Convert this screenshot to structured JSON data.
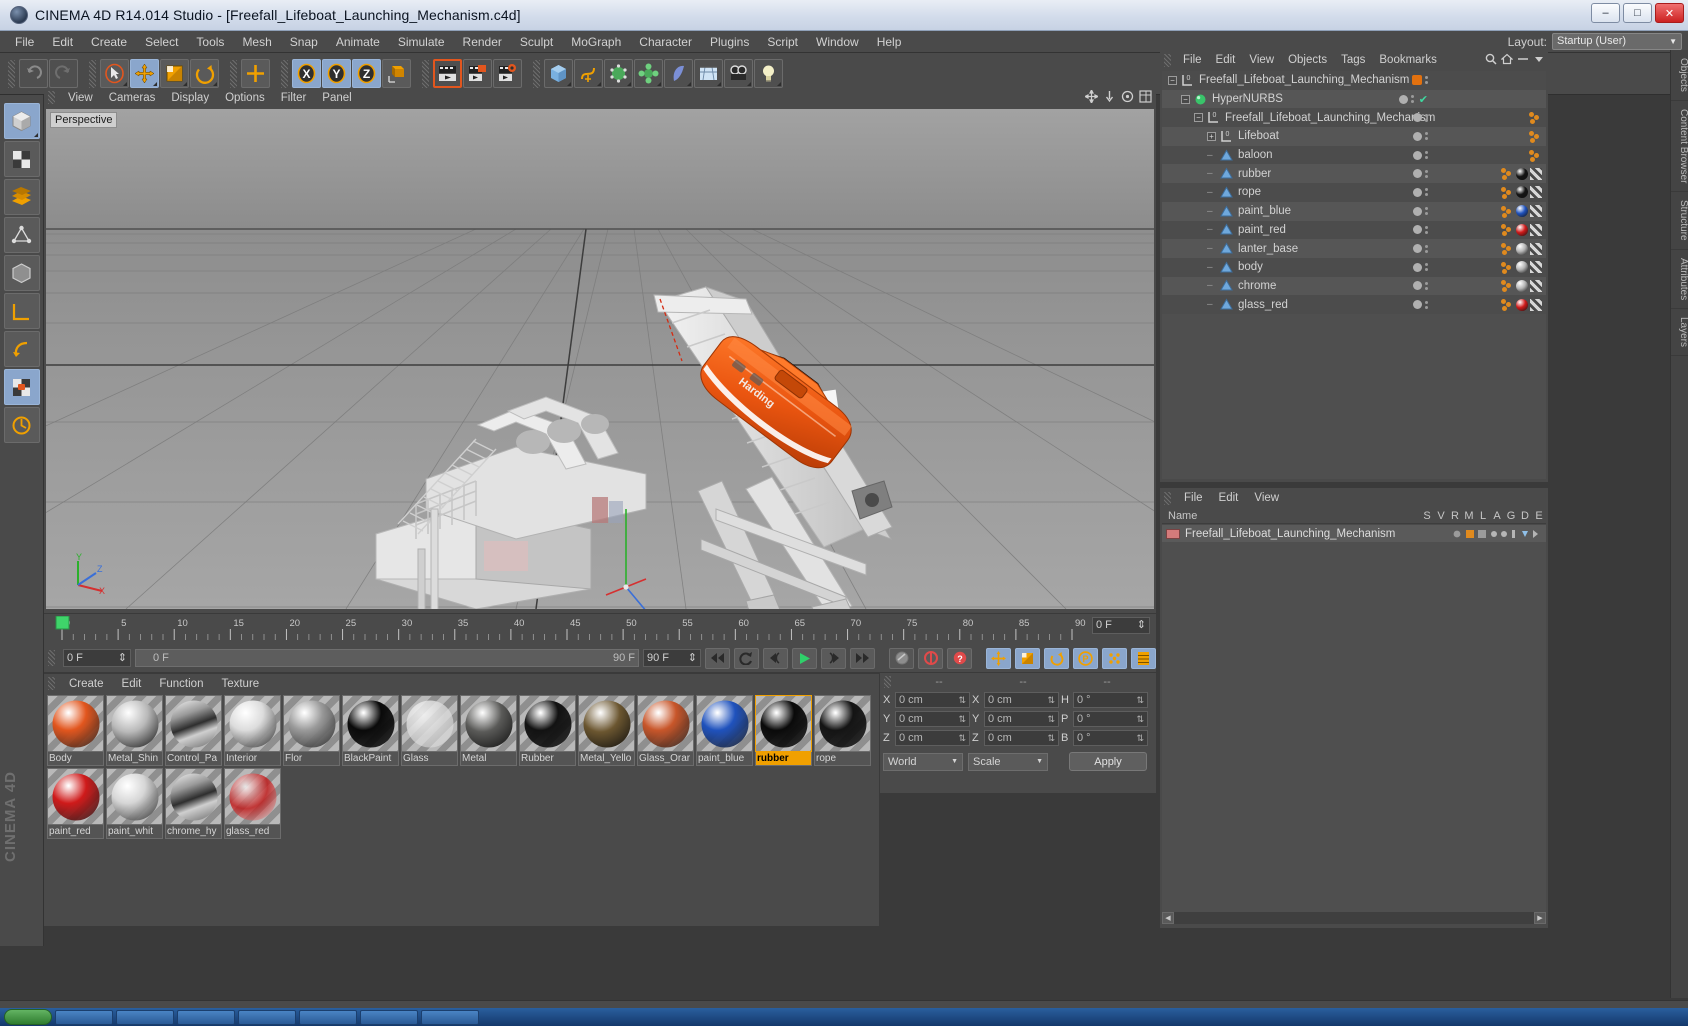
{
  "window": {
    "title": "CINEMA 4D R14.014 Studio - [Freefall_Lifeboat_Launching_Mechanism.c4d]",
    "minimize": "–",
    "maximize": "□",
    "close": "✕"
  },
  "menubar": {
    "items": [
      "File",
      "Edit",
      "Create",
      "Select",
      "Tools",
      "Mesh",
      "Snap",
      "Animate",
      "Simulate",
      "Render",
      "Sculpt",
      "MoGraph",
      "Character",
      "Plugins",
      "Script",
      "Window",
      "Help"
    ],
    "layout_label": "Layout:",
    "layout_value": "Startup (User)"
  },
  "viewport": {
    "menu": [
      "View",
      "Cameras",
      "Display",
      "Options",
      "Filter",
      "Panel"
    ],
    "view_label": "Perspective",
    "axis_x": "X",
    "axis_y": "Y",
    "axis_z": "Z"
  },
  "timeline": {
    "tick_labels": [
      "0",
      "5",
      "10",
      "15",
      "20",
      "25",
      "30",
      "35",
      "40",
      "45",
      "50",
      "55",
      "60",
      "65",
      "70",
      "75",
      "80",
      "85",
      "90"
    ],
    "current_frame_top": "0 F",
    "current_frame": "0 F",
    "scrub_start": "0 F",
    "scrub_end": "90 F",
    "range_end": "90 F"
  },
  "materials": {
    "menu": [
      "Create",
      "Edit",
      "Function",
      "Texture"
    ],
    "items": [
      {
        "name": "Body",
        "color": "#e2561e",
        "type": "glossy",
        "selected": false
      },
      {
        "name": "Metal_Shin",
        "color": "#b9b9b9",
        "type": "metal",
        "selected": false
      },
      {
        "name": "Control_Pa",
        "color": "#8c8c8c",
        "type": "chrome",
        "selected": false
      },
      {
        "name": "Interior",
        "color": "#dcdcdc",
        "type": "matte",
        "selected": false
      },
      {
        "name": "Flor",
        "color": "#9a9a9a",
        "type": "matte",
        "selected": false
      },
      {
        "name": "BlackPaint",
        "color": "#0a0a0a",
        "type": "glossy",
        "selected": false
      },
      {
        "name": "Glass",
        "color": "#d8d8d8",
        "type": "glass",
        "selected": false
      },
      {
        "name": "Metal",
        "color": "#5a5a58",
        "type": "metal",
        "selected": false
      },
      {
        "name": "Rubber",
        "color": "#121212",
        "type": "matte",
        "selected": false
      },
      {
        "name": "Metal_Yello",
        "color": "#6b5630",
        "type": "metal",
        "selected": false
      },
      {
        "name": "Glass_Orar",
        "color": "#c8562a",
        "type": "glossy",
        "selected": false
      },
      {
        "name": "paint_blue",
        "color": "#1f52bd",
        "type": "glossy",
        "selected": false
      },
      {
        "name": "rubber",
        "color": "#0a0a0a",
        "type": "matte",
        "selected": true
      },
      {
        "name": "rope",
        "color": "#141414",
        "type": "matte",
        "selected": false
      },
      {
        "name": "paint_red",
        "color": "#cf1a1a",
        "type": "glossy",
        "selected": false
      },
      {
        "name": "paint_whit",
        "color": "#d6d6d6",
        "type": "matte",
        "selected": false
      },
      {
        "name": "chrome_hy",
        "color": "#b4b4b4",
        "type": "chrome",
        "selected": false
      },
      {
        "name": "glass_red",
        "color": "#c21a1a",
        "type": "glass",
        "selected": false
      }
    ]
  },
  "coordinates": {
    "header": [
      "--",
      "--",
      "--"
    ],
    "rows": [
      {
        "label": "X",
        "position": "0 cm",
        "label2": "X",
        "size": "0 cm",
        "label3": "H",
        "rotation": "0 °"
      },
      {
        "label": "Y",
        "position": "0 cm",
        "label2": "Y",
        "size": "0 cm",
        "label3": "P",
        "rotation": "0 °"
      },
      {
        "label": "Z",
        "position": "0 cm",
        "label2": "Z",
        "size": "0 cm",
        "label3": "B",
        "rotation": "0 °"
      }
    ],
    "space_select": "World",
    "scale_select": "Scale",
    "apply_label": "Apply"
  },
  "objects": {
    "menu": [
      "File",
      "Edit",
      "View",
      "Objects",
      "Tags",
      "Bookmarks"
    ],
    "rows": [
      {
        "name": "Freefall_Lifeboat_Launching_Mechanism",
        "indent": 0,
        "icon": "null-icon",
        "expander": "−",
        "dot": "orange",
        "check": false,
        "tags": []
      },
      {
        "name": "HyperNURBS",
        "indent": 1,
        "icon": "hypernurbs-icon",
        "expander": "−",
        "dot": "gray",
        "check": true,
        "tags": []
      },
      {
        "name": "Freefall_Lifeboat_Launching_Mechanism",
        "indent": 2,
        "icon": "null-icon",
        "expander": "−",
        "dot": "gray",
        "check": false,
        "tags": [
          "dots"
        ]
      },
      {
        "name": "Lifeboat",
        "indent": 3,
        "icon": "null-icon",
        "expander": "+",
        "dot": "gray",
        "check": false,
        "tags": [
          "dots"
        ]
      },
      {
        "name": "baloon",
        "indent": 3,
        "icon": "polygon-icon",
        "expander": "",
        "dot": "gray",
        "check": false,
        "tags": [
          "dots"
        ]
      },
      {
        "name": "rubber",
        "indent": 3,
        "icon": "polygon-icon",
        "expander": "",
        "dot": "gray",
        "check": false,
        "tags": [
          "dots",
          "mat-black",
          "chk"
        ]
      },
      {
        "name": "rope",
        "indent": 3,
        "icon": "polygon-icon",
        "expander": "",
        "dot": "gray",
        "check": false,
        "tags": [
          "dots",
          "mat-black",
          "chk"
        ]
      },
      {
        "name": "paint_blue",
        "indent": 3,
        "icon": "polygon-icon",
        "expander": "",
        "dot": "gray",
        "check": false,
        "tags": [
          "dots",
          "mat-blue",
          "chk"
        ]
      },
      {
        "name": "paint_red",
        "indent": 3,
        "icon": "polygon-icon",
        "expander": "",
        "dot": "gray",
        "check": false,
        "tags": [
          "dots",
          "mat-red",
          "chk"
        ]
      },
      {
        "name": "lanter_base",
        "indent": 3,
        "icon": "polygon-icon",
        "expander": "",
        "dot": "gray",
        "check": false,
        "tags": [
          "dots",
          "mat-gray",
          "chk"
        ]
      },
      {
        "name": "body",
        "indent": 3,
        "icon": "polygon-icon",
        "expander": "",
        "dot": "gray",
        "check": false,
        "tags": [
          "dots",
          "mat-gray",
          "chk"
        ]
      },
      {
        "name": "chrome",
        "indent": 3,
        "icon": "polygon-icon",
        "expander": "",
        "dot": "gray",
        "check": false,
        "tags": [
          "dots",
          "mat-gray",
          "chk"
        ]
      },
      {
        "name": "glass_red",
        "indent": 3,
        "icon": "polygon-icon",
        "expander": "",
        "dot": "gray",
        "check": false,
        "tags": [
          "dots",
          "mat-red",
          "chk"
        ]
      }
    ]
  },
  "attributes": {
    "menu": [
      "File",
      "Edit",
      "View"
    ],
    "name_col": "Name",
    "cols": [
      "S",
      "V",
      "R",
      "M",
      "L",
      "A",
      "G",
      "D",
      "E"
    ],
    "row_name": "Freefall_Lifeboat_Launching_Mechanism"
  },
  "rail": {
    "items": [
      "Objects",
      "Content Browser",
      "Structure",
      "Attributes",
      "Layers"
    ]
  },
  "colors": {
    "accent_orange": "#e2710f",
    "selection_blue": "#8aa6cc",
    "panel_bg": "#4a4a4a",
    "selected_material": "#f0a000"
  }
}
